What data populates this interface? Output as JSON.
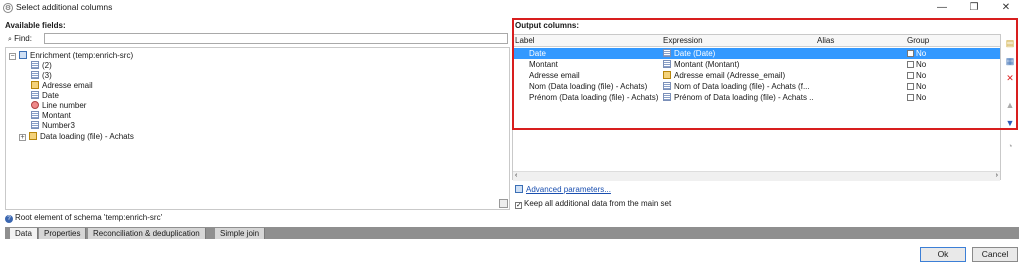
{
  "window": {
    "title": "Select additional columns",
    "minimize": "—",
    "maximize": "❐",
    "close": "✕"
  },
  "left": {
    "available_label": "Available fields:",
    "find_label": "Find:",
    "find_value": "",
    "tree": [
      {
        "label": "Enrichment (temp:enrich-src)",
        "icon": "table-icon"
      },
      {
        "label": "(2)",
        "icon": "field-icon"
      },
      {
        "label": "(3)",
        "icon": "field-icon"
      },
      {
        "label": "Adresse email",
        "icon": "link-field-icon"
      },
      {
        "label": "Date",
        "icon": "field-icon"
      },
      {
        "label": "Line number",
        "icon": "key-icon"
      },
      {
        "label": "Montant",
        "icon": "field-icon"
      },
      {
        "label": "Number3",
        "icon": "field-icon"
      },
      {
        "label": "Data loading (file) - Achats",
        "icon": "link-table-icon"
      }
    ],
    "status": "Root element of schema 'temp:enrich-src'"
  },
  "right": {
    "output_label": "Output columns:",
    "headers": {
      "label": "Label",
      "expression": "Expression",
      "alias": "Alias",
      "group": "Group"
    },
    "rows": [
      {
        "label": "Date",
        "expression": "Date (Date)",
        "alias": "",
        "group": "No",
        "selected": true
      },
      {
        "label": "Montant",
        "expression": "Montant (Montant)",
        "alias": "",
        "group": "No",
        "selected": false
      },
      {
        "label": "Adresse email",
        "expression": "Adresse email (Adresse_email)",
        "alias": "",
        "group": "No",
        "selected": false
      },
      {
        "label": "Nom (Data loading (file) - Achats)",
        "expression": "Nom of Data loading (file) - Achats (f...",
        "alias": "",
        "group": "No",
        "selected": false
      },
      {
        "label": "Prénom (Data loading (file) - Achats)",
        "expression": "Prénom of Data loading (file) - Achats ...",
        "alias": "",
        "group": "No",
        "selected": false
      }
    ],
    "advanced_link": "Advanced parameters...",
    "keep_label": "Keep all additional data from the main set",
    "keep_checked": true
  },
  "tabs": [
    "Data",
    "Properties",
    "Reconciliation & deduplication",
    "Simple join"
  ],
  "buttons": {
    "ok": "Ok",
    "cancel": "Cancel"
  },
  "colors": {
    "selection": "#3399ff",
    "highlight_box": "#d81e1e",
    "tab_bar": "#8f8f8f"
  }
}
